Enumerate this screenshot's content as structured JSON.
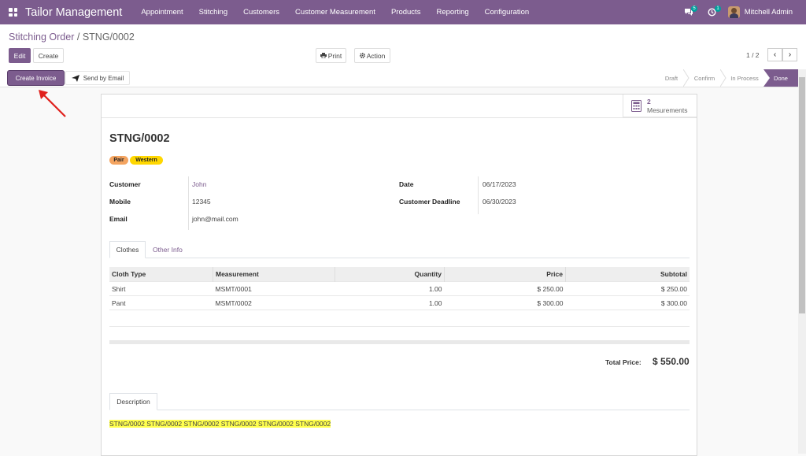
{
  "navbar": {
    "app_title": "Tailor Management",
    "menu": [
      "Appointment",
      "Stitching",
      "Customers",
      "Customer Measurement",
      "Products",
      "Reporting",
      "Configuration"
    ],
    "messages_count": "5",
    "activities_count": "1",
    "user_name": "Mitchell Admin",
    "color": "#7c5c8e"
  },
  "breadcrumb": {
    "parent": "Stitching Order",
    "separator": "/",
    "current": "STNG/0002"
  },
  "toolbar": {
    "edit_label": "Edit",
    "create_label": "Create",
    "print_label": "Print",
    "action_label": "Action",
    "pager": "1 / 2"
  },
  "header_buttons": {
    "create_invoice": "Create Invoice",
    "send_by_email": "Send by Email"
  },
  "stages": {
    "items": [
      "Draft",
      "Confirm",
      "In Process"
    ],
    "active": "Done"
  },
  "smart_button": {
    "count": "2",
    "label": "Mesurements",
    "icon": "calculator-icon"
  },
  "record": {
    "name": "STNG/0002",
    "tags": [
      {
        "label": "Pair",
        "color": "#f4a460"
      },
      {
        "label": "Western",
        "color": "#ffd700"
      }
    ],
    "fields": {
      "customer_label": "Customer",
      "customer": "John",
      "mobile_label": "Mobile",
      "mobile": "12345",
      "email_label": "Email",
      "email": "john@mail.com",
      "date_label": "Date",
      "date": "06/17/2023",
      "deadline_label": "Customer Deadline",
      "deadline": "06/30/2023"
    }
  },
  "tabs": [
    "Clothes",
    "Other Info"
  ],
  "lines": {
    "headers": [
      "Cloth Type",
      "Measurement",
      "Quantity",
      "Price",
      "Subtotal"
    ],
    "rows": [
      [
        "Shirt",
        "MSMT/0001",
        "1.00",
        "$ 250.00",
        "$ 250.00"
      ],
      [
        "Pant",
        "MSMT/0002",
        "1.00",
        "$ 300.00",
        "$ 300.00"
      ]
    ]
  },
  "total": {
    "label": "Total Price:",
    "value": "$ 550.00"
  },
  "description": {
    "tab_label": "Description",
    "text": "STNG/0002 STNG/0002 STNG/0002 STNG/0002 STNG/0002 STNG/0002"
  }
}
